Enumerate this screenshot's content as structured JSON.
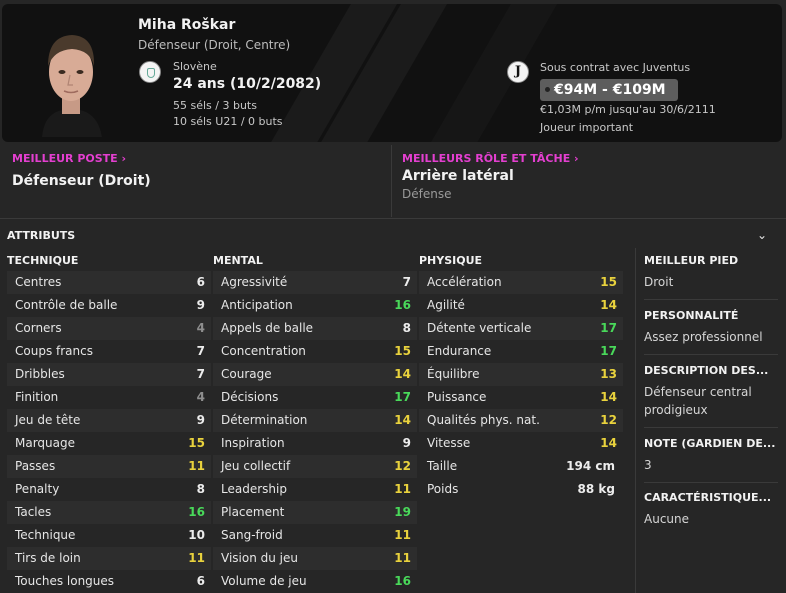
{
  "player": {
    "name": "Miha Roškar",
    "positions": "Défenseur (Droit, Centre)",
    "nationality": "Slovène",
    "age": "24 ans (10/2/2082)",
    "caps": "55 séls / 3 buts",
    "u21_caps": "10 séls U21 / 0 buts",
    "club_badge": "J",
    "contract": "Sous contrat avec Juventus",
    "value": "€94M - €109M",
    "wage": "€1,03M p/m jusqu'au 30/6/2111",
    "status": "Joueur important"
  },
  "best_position": {
    "label": "MEILLEUR POSTE",
    "value": "Défenseur (Droit)"
  },
  "best_role": {
    "label": "MEILLEURS RÔLE ET TÂCHE",
    "value": "Arrière latéral",
    "duty": "Défense"
  },
  "attributes": {
    "title": "ATTRIBUTS",
    "technical_title": "TECHNIQUE",
    "mental_title": "MENTAL",
    "physical_title": "PHYSIQUE",
    "technical": [
      {
        "name": "Centres",
        "value": "6",
        "tier": "white"
      },
      {
        "name": "Contrôle de balle",
        "value": "9",
        "tier": "white"
      },
      {
        "name": "Corners",
        "value": "4",
        "tier": "grey"
      },
      {
        "name": "Coups francs",
        "value": "7",
        "tier": "white"
      },
      {
        "name": "Dribbles",
        "value": "7",
        "tier": "white"
      },
      {
        "name": "Finition",
        "value": "4",
        "tier": "grey"
      },
      {
        "name": "Jeu de tête",
        "value": "9",
        "tier": "white"
      },
      {
        "name": "Marquage",
        "value": "15",
        "tier": "yellow"
      },
      {
        "name": "Passes",
        "value": "11",
        "tier": "yellow"
      },
      {
        "name": "Penalty",
        "value": "8",
        "tier": "white"
      },
      {
        "name": "Tacles",
        "value": "16",
        "tier": "green"
      },
      {
        "name": "Technique",
        "value": "10",
        "tier": "white"
      },
      {
        "name": "Tirs de loin",
        "value": "11",
        "tier": "yellow"
      },
      {
        "name": "Touches longues",
        "value": "6",
        "tier": "white"
      }
    ],
    "mental": [
      {
        "name": "Agressivité",
        "value": "7",
        "tier": "white"
      },
      {
        "name": "Anticipation",
        "value": "16",
        "tier": "green"
      },
      {
        "name": "Appels de balle",
        "value": "8",
        "tier": "white"
      },
      {
        "name": "Concentration",
        "value": "15",
        "tier": "yellow"
      },
      {
        "name": "Courage",
        "value": "14",
        "tier": "yellow"
      },
      {
        "name": "Décisions",
        "value": "17",
        "tier": "green"
      },
      {
        "name": "Détermination",
        "value": "14",
        "tier": "yellow"
      },
      {
        "name": "Inspiration",
        "value": "9",
        "tier": "white"
      },
      {
        "name": "Jeu collectif",
        "value": "12",
        "tier": "yellow"
      },
      {
        "name": "Leadership",
        "value": "11",
        "tier": "yellow"
      },
      {
        "name": "Placement",
        "value": "19",
        "tier": "green"
      },
      {
        "name": "Sang-froid",
        "value": "11",
        "tier": "yellow"
      },
      {
        "name": "Vision du jeu",
        "value": "11",
        "tier": "yellow"
      },
      {
        "name": "Volume de jeu",
        "value": "16",
        "tier": "green"
      }
    ],
    "physical": [
      {
        "name": "Accélération",
        "value": "15",
        "tier": "yellow"
      },
      {
        "name": "Agilité",
        "value": "14",
        "tier": "yellow"
      },
      {
        "name": "Détente verticale",
        "value": "17",
        "tier": "green"
      },
      {
        "name": "Endurance",
        "value": "17",
        "tier": "green"
      },
      {
        "name": "Équilibre",
        "value": "13",
        "tier": "yellow"
      },
      {
        "name": "Puissance",
        "value": "14",
        "tier": "yellow"
      },
      {
        "name": "Qualités phys. nat.",
        "value": "12",
        "tier": "yellow"
      },
      {
        "name": "Vitesse",
        "value": "14",
        "tier": "yellow"
      }
    ],
    "height_label": "Taille",
    "height": "194 cm",
    "weight_label": "Poids",
    "weight": "88 kg"
  },
  "side": {
    "foot_label": "MEILLEUR PIED",
    "foot": "Droit",
    "personality_label": "PERSONNALITÉ",
    "personality": "Assez professionnel",
    "description_label": "DESCRIPTION DES...",
    "description": "Défenseur central prodigieux",
    "rating_label": "NOTE (GARDIEN DE...",
    "rating": "3",
    "traits_label": "CARACTÉRISTIQUE...",
    "traits": "Aucune"
  },
  "colors": {
    "accent": "#e43fd0",
    "grey": "#8e8e8e",
    "white": "#ececec",
    "yellow": "#e9d23d",
    "green": "#49d95a"
  },
  "icons": {
    "flag": "slovenia-flag-icon",
    "club": "juventus-badge-icon",
    "collapse": "chevron-down-icon",
    "link": "chevron-right-icon"
  }
}
